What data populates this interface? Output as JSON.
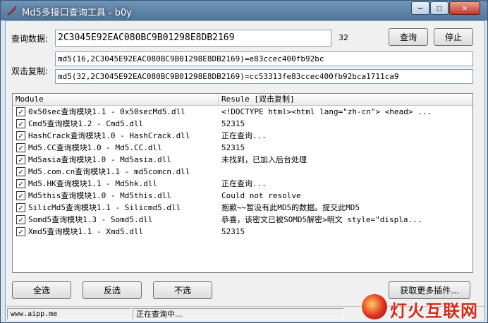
{
  "window": {
    "title": "Md5多接口查询工具 - b0y",
    "minimize_glyph": "–",
    "maximize_glyph": "□",
    "close_glyph": "✕"
  },
  "query": {
    "label": "查询数据:",
    "value": "2C3045E92EAC080BC9B01298E8DB2169",
    "length": "32",
    "search_button": "查询",
    "stop_button": "停止"
  },
  "copy": {
    "label": "双击复制:",
    "result16": "md5(16,2C3045E92EAC080BC9B01298E8DB2169)=e83ccec400fb92bc",
    "result32": "md5(32,2C3045E92EAC080BC9B01298E8DB2169)=cc53313fe83ccec400fb92bca1711ca9"
  },
  "list": {
    "columns": [
      "Module",
      "Resule [双击复制]"
    ],
    "rows": [
      {
        "checked": true,
        "module": "0x50sec查询模块1.1 - 0x50secMd5.dll",
        "result": "<!DOCTYPE html><html lang=\"zh-cn\">  <head>   ..."
      },
      {
        "checked": true,
        "module": "Cmd5查询模块1.2 - Cmd5.dll",
        "result": "52315"
      },
      {
        "checked": true,
        "module": "HashCrack查询模块1.0 - HashCrack.dll",
        "result": "正在查询..."
      },
      {
        "checked": true,
        "module": "Md5.CC查询模块1.0 - Md5.CC.dll",
        "result": "52315"
      },
      {
        "checked": true,
        "module": "Md5asia查询模块1.0 - Md5asia.dll",
        "result": "未找到，已加入后台处理"
      },
      {
        "checked": true,
        "module": "Md5.com.cn查询模块1.1 - md5comcn.dll",
        "result": ""
      },
      {
        "checked": true,
        "module": "Md5.HK查询模块1.1 - Md5hk.dll",
        "result": "正在查询..."
      },
      {
        "checked": true,
        "module": "Md5this查询模块1.0 - Md5this.dll",
        "result": "Could not resolve"
      },
      {
        "checked": true,
        "module": "SilicMd5查询模块1.1 - Silicmd5.dll",
        "result": "抱歉~~暂没有此MD5的数据。提交此MD5"
      },
      {
        "checked": true,
        "module": "Somd5查询模块1.3 - Somd5.dll",
        "result": "恭喜，该密文已被SOMD5解密>明文  style=\"displa..."
      },
      {
        "checked": true,
        "module": "Xmd5查询模块1.1 - Xmd5.dll",
        "result": "52315"
      }
    ]
  },
  "buttons": {
    "select_all": "全选",
    "invert": "反选",
    "select_none": "不选",
    "more_plugins": "获取更多插件..."
  },
  "status": {
    "site": "www.aipp.me",
    "message": "正在查询中..."
  },
  "watermark": {
    "text": "灯火互联网"
  },
  "colors": {
    "title_bar": "#5a82a8",
    "watermark_red": "#d42a1a"
  }
}
